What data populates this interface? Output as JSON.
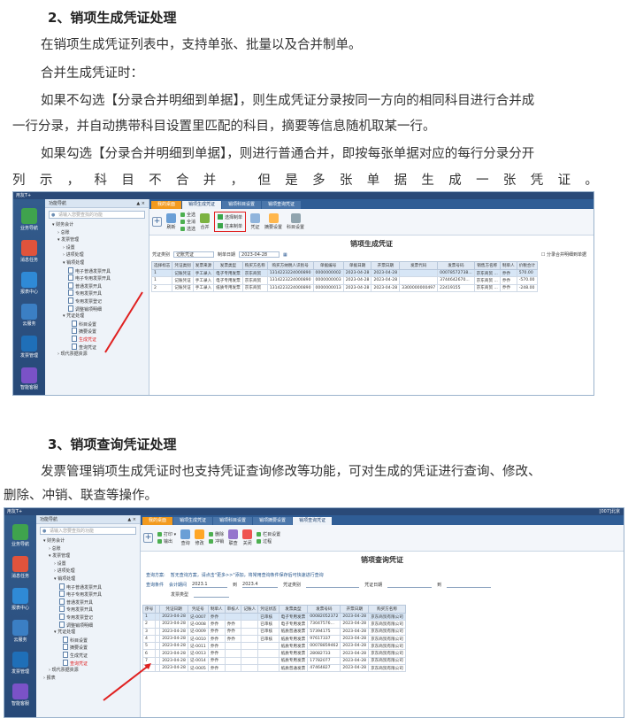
{
  "section2": {
    "heading": "2、销项生成凭证处理",
    "p1": "在销项生成凭证列表中，支持单张、批量以及合并制单。",
    "p2": "合并生成凭证时：",
    "p3_line1": "如果不勾选【分录合并明细到单据】，则生成凭证分录按同一方向的相同科目进行合并成",
    "p3_line2": "一行分录，并自动携带科目设置里匹配的科目，摘要等信息随机取某一行。",
    "p4_line1": "如果勾选【分录合并明细到单据】，则进行普通合并，即按每张单据对应的每行分录分开",
    "p4_line2_chars": [
      "列",
      "示",
      "，",
      "科",
      "目",
      "不",
      "合",
      "并",
      "，",
      "但",
      "是",
      "多",
      "张",
      "单",
      "据",
      "生",
      "成",
      "一",
      "张",
      "凭",
      "证",
      "。"
    ]
  },
  "section3": {
    "heading": "3、销项查询凭证处理",
    "p1_line1": "发票管理销项生成凭证时也支持凭证查询修改等功能，可对生成的凭证进行查询、修改、",
    "p1_line2": "删除、冲销、联查等操作。"
  },
  "app": {
    "title": "用友T+",
    "title_right": "[007]北京",
    "left_nav": [
      "业务导航",
      "消息任务",
      "报表中心",
      "云服务",
      "发票管理",
      "智能客服"
    ],
    "tree_header": "功能导航",
    "search_placeholder": "请输入您要查找的功能",
    "colors": {
      "titlebar": "#2a4a78",
      "accent": "#f29a1e",
      "highlight": "#e02020"
    }
  },
  "shot1": {
    "tabs": [
      "我的桌面",
      "销项生成凭证",
      "销项科目设置",
      "销项查询凭证"
    ],
    "active_tab": 1,
    "tree": [
      {
        "label": "▾ 财务会计",
        "indent": 8,
        "doc": false
      },
      {
        "label": "› 总账",
        "indent": 14,
        "doc": false
      },
      {
        "label": "▾ 发票管理",
        "indent": 14,
        "doc": false
      },
      {
        "label": "› 设置",
        "indent": 20,
        "doc": false
      },
      {
        "label": "› 进项处理",
        "indent": 20,
        "doc": false
      },
      {
        "label": "▾ 销项处理",
        "indent": 20,
        "doc": false
      },
      {
        "label": "电子普通发票开具",
        "indent": 26,
        "doc": true
      },
      {
        "label": "电子专用发票开具",
        "indent": 26,
        "doc": true
      },
      {
        "label": "普通发票开具",
        "indent": 26,
        "doc": true
      },
      {
        "label": "专用发票开具",
        "indent": 26,
        "doc": true
      },
      {
        "label": "专用发票登记",
        "indent": 26,
        "doc": true
      },
      {
        "label": "调整销项明细",
        "indent": 26,
        "doc": true
      },
      {
        "label": "▾ 凭证处理",
        "indent": 20,
        "doc": false
      },
      {
        "label": "科目设置",
        "indent": 30,
        "doc": true
      },
      {
        "label": "摘要设置",
        "indent": 30,
        "doc": true
      },
      {
        "label": "生成凭证",
        "indent": 30,
        "doc": true,
        "sel": true
      },
      {
        "label": "查询凭证",
        "indent": 30,
        "doc": true
      },
      {
        "label": "› 现代票据资源",
        "indent": 14,
        "doc": false
      }
    ],
    "toolbar": {
      "refresh": "刷新",
      "query": "查询",
      "group_a": [
        "全选",
        "全消",
        "选选"
      ],
      "merge": "合并",
      "redbox": [
        "选择制单",
        "往来制单"
      ],
      "btns": [
        "凭证",
        "摘要设置",
        "科目设置"
      ]
    },
    "title": "销项生成凭证",
    "filter": {
      "voucher_type_label": "凭证类别",
      "voucher_type_value": "记账凭证",
      "date_label": "制单日期",
      "date_value": "2023-04-28",
      "merge_checkbox": "分录合并明细到单据"
    },
    "columns": [
      "选择标志",
      "凭证类别",
      "发票来源",
      "发票类型",
      "购买方名称",
      "购买方纳税人识别号",
      "单据编号",
      "单据日期",
      "开票日期",
      "发票代码",
      "发票号码",
      "销售方名称",
      "制单人",
      "价税合计"
    ],
    "rows": [
      [
        "1",
        "记账凭证",
        "手工录入",
        "电子专用发票",
        "京东商贸",
        "1314223224000890",
        "0000000002",
        "2023-04-28",
        "2023-04-28",
        "",
        "00078572738...",
        "京东商贸 ...",
        "乔乔",
        "570.00"
      ],
      [
        "1",
        "记账凭证",
        "手工录入",
        "电子专用发票",
        "京东商贸",
        "1314223224000890",
        "0000000003",
        "2023-04-28",
        "2023-04-28",
        "",
        "3744642670...",
        "京东商贸 ...",
        "乔乔",
        "-570.00"
      ],
      [
        "2",
        "记账凭证",
        "手工录入",
        "纸质专用发票",
        "京东商贸",
        "1314223224000890",
        "0000000013",
        "2023-04-28",
        "2023-04-28",
        "3300000000497",
        "22419155",
        "京东商贸 ...",
        "乔乔",
        "-248.00"
      ]
    ]
  },
  "shot2": {
    "tabs": [
      "我的桌面",
      "销项生成凭证",
      "销项科目设置",
      "销项摘要设置",
      "销项查询凭证"
    ],
    "active_tab": 4,
    "tree": [
      {
        "label": "▾ 财务会计",
        "indent": 8,
        "doc": false
      },
      {
        "label": "› 总账",
        "indent": 14,
        "doc": false
      },
      {
        "label": "▾ 发票管理",
        "indent": 14,
        "doc": false
      },
      {
        "label": "› 设置",
        "indent": 20,
        "doc": false
      },
      {
        "label": "› 进项处理",
        "indent": 20,
        "doc": false
      },
      {
        "label": "▾ 销项处理",
        "indent": 20,
        "doc": false
      },
      {
        "label": "电子普通发票开具",
        "indent": 26,
        "doc": true
      },
      {
        "label": "电子专用发票开具",
        "indent": 26,
        "doc": true
      },
      {
        "label": "普通发票开具",
        "indent": 26,
        "doc": true
      },
      {
        "label": "专用发票开具",
        "indent": 26,
        "doc": true
      },
      {
        "label": "专用发票登记",
        "indent": 26,
        "doc": true
      },
      {
        "label": "调整销项明细",
        "indent": 26,
        "doc": true
      },
      {
        "label": "▾ 凭证处理",
        "indent": 20,
        "doc": false
      },
      {
        "label": "科目设置",
        "indent": 30,
        "doc": true
      },
      {
        "label": "摘要设置",
        "indent": 30,
        "doc": true
      },
      {
        "label": "生成凭证",
        "indent": 30,
        "doc": true
      },
      {
        "label": "查询凭证",
        "indent": 30,
        "doc": true,
        "sel": true
      },
      {
        "label": "› 现代票据资源",
        "indent": 14,
        "doc": false
      },
      {
        "label": "› 报表",
        "indent": 8,
        "doc": false
      }
    ],
    "toolbar": {
      "group_a": [
        "打印 ▾",
        "输出"
      ],
      "query": "查询",
      "modify": "修改",
      "group_b": [
        "删除",
        "冲销"
      ],
      "link": "联查",
      "close": "关闭",
      "group_c": [
        "栏目设置",
        "过程"
      ]
    },
    "title": "销项查询凭证",
    "query": {
      "plan_label": "查询方案:",
      "plan_hint": "暂无查询方案，请点击\"更多>>\"添加，将常用查询条件保存后可快速进行查询",
      "cond_label": "查询条件",
      "period_label": "会计期间",
      "period_from": "2023.1",
      "period_to_label": "到",
      "period_to": "2023.4",
      "type_label": "凭证类别",
      "date_label": "凭证日期",
      "date_to_label": "到",
      "source_label": "发票类型"
    },
    "columns": [
      "序号",
      "",
      "凭证日期",
      "凭证号",
      "制单人",
      "审核人",
      "记账人",
      "凭证状态",
      "发票类型",
      "发票号码",
      "开票日期",
      "购买方名称"
    ],
    "rows": [
      [
        "1",
        "",
        "2023-04-28",
        "记-0007",
        "乔乔",
        "",
        "",
        "已审核",
        "电子专用发票",
        "00082052372",
        "2023-04-28",
        "京东商贸有限公司"
      ],
      [
        "2",
        "",
        "2023-04-28",
        "记-0008",
        "乔乔",
        "乔乔",
        "",
        "已审核",
        "电子专用发票",
        "73047576... ",
        "2023-04-28",
        "京东商贸有限公司"
      ],
      [
        "3",
        "",
        "2023-04-28",
        "记-0009",
        "乔乔",
        "乔乔",
        "",
        "已审核",
        "纸质普通发票",
        "57394175",
        "2023-04-28",
        "京东商贸有限公司"
      ],
      [
        "4",
        "",
        "2023-04-28",
        "记-0010",
        "乔乔",
        "乔乔",
        "",
        "已审核",
        "纸质专用发票",
        "97617337",
        "2023-04-28",
        "京东商贸有限公司"
      ],
      [
        "5",
        "",
        "2023-04-28",
        "记-0011",
        "乔乔",
        "",
        "",
        "",
        "纸质专用发票",
        "00078859462",
        "2023-04-28",
        "京东商贸有限公司"
      ],
      [
        "6",
        "",
        "2023-04-28",
        "记-0013",
        "乔乔",
        "",
        "",
        "",
        "纸质专用发票",
        "28082733",
        "2023-04-28",
        "京东商贸有限公司"
      ],
      [
        "7",
        "",
        "2023-04-28",
        "记-0014",
        "乔乔",
        "",
        "",
        "",
        "纸质专用发票",
        "17782077",
        "2023-04-28",
        "京东商贸有限公司"
      ],
      [
        "8",
        "",
        "2023-04-28",
        "记-0005",
        "乔乔",
        "",
        "",
        "",
        "纸质普通发票",
        "47464827",
        "2023-04-28",
        "京东商贸有限公司"
      ]
    ]
  }
}
